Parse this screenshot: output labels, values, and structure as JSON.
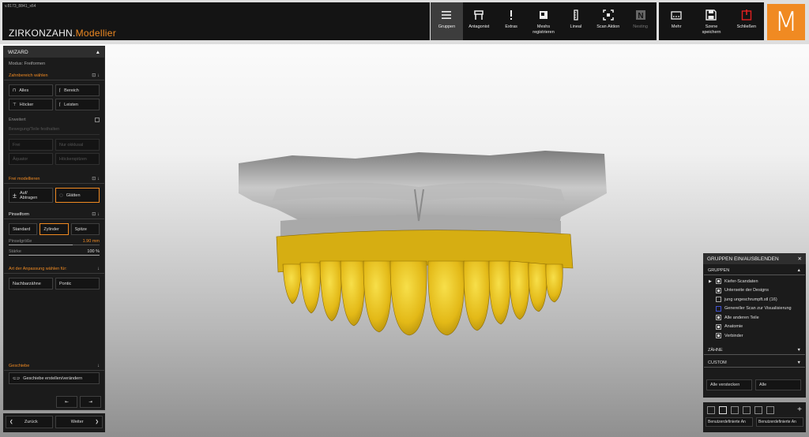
{
  "app": {
    "version": "v.8173_8841_x64",
    "brand_main": "ZIRKONZAHN.",
    "brand_accent": "Modellier",
    "logo_letter": "M"
  },
  "toolbar": {
    "gruppen": "Gruppen",
    "antagonist": "Antagonist",
    "extras": "Extras",
    "meshs_line1": "Meshs",
    "meshs_line2": "registrieren",
    "lineal": "Lineal",
    "scan_aktion": "Scan Aktion",
    "nesting": "Nesting",
    "mehr": "Mehr",
    "szene_line1": "Szene",
    "szene_line2": "speichern",
    "schliessen": "Schließen"
  },
  "wizard": {
    "title": "WIZARD",
    "modus": "Modus: Freiformen",
    "zahnbereich": "Zahnbereich wählen",
    "alles": "Alles",
    "bereich": "Bereich",
    "hoecker": "Höcker",
    "leisten": "Leisten",
    "erweitert": "Erweitert",
    "bewegung": "Bewegung/Teile festhalten",
    "frei": "Frei",
    "nur_okklusal": "Nur okklusal",
    "aequator": "Äquator",
    "hoeckerspitzen": "Höckerspitzen",
    "frei_modellieren": "Frei modellieren",
    "auf_line1": "Auf/",
    "auf_line2": "Abtragen",
    "glaetten": "Glätten",
    "pinselform": "Pinselform",
    "standard": "Standard",
    "zylinder": "Zylinder",
    "spitze": "Spitze",
    "pinselgroesse": "Pinselgröße",
    "pinselgroesse_val": "1.90 mm",
    "staerke": "Stärke",
    "staerke_val": "100 %",
    "art_anpassung": "Art der Anpassung wählen für:",
    "nachbarzaehne": "Nachbarzähne",
    "pontic": "Pontic",
    "geschiebe": "Geschiebe",
    "geschiebe_btn": "Geschiebe erstellen/verändern"
  },
  "nav": {
    "zurueck": "Zurück",
    "weiter": "Weiter"
  },
  "groups": {
    "title": "GRUPPEN EIN/AUSBLENDEN",
    "section_gruppen": "GRUPPEN",
    "items": [
      "Kiefer-Scandaten",
      "Unterseite der Designs",
      "jung ungeschrumpft.stl (16)",
      "Genereller Scan zur Visualisierung",
      "Alle anderen Teile",
      "Anatomie",
      "Verbinder"
    ],
    "section_zaehne": "ZÄHNE",
    "section_custom": "CUSTOM",
    "alle_verstecken": "Alle verstecken",
    "alle": "Alle",
    "preset_1": "Benutzerdefinierte An",
    "preset_2": "Benutzerdefinierte An"
  },
  "colors": {
    "accent": "#f08a22",
    "teeth": "#e8c11c",
    "gingiva": "#a8a8a8"
  }
}
